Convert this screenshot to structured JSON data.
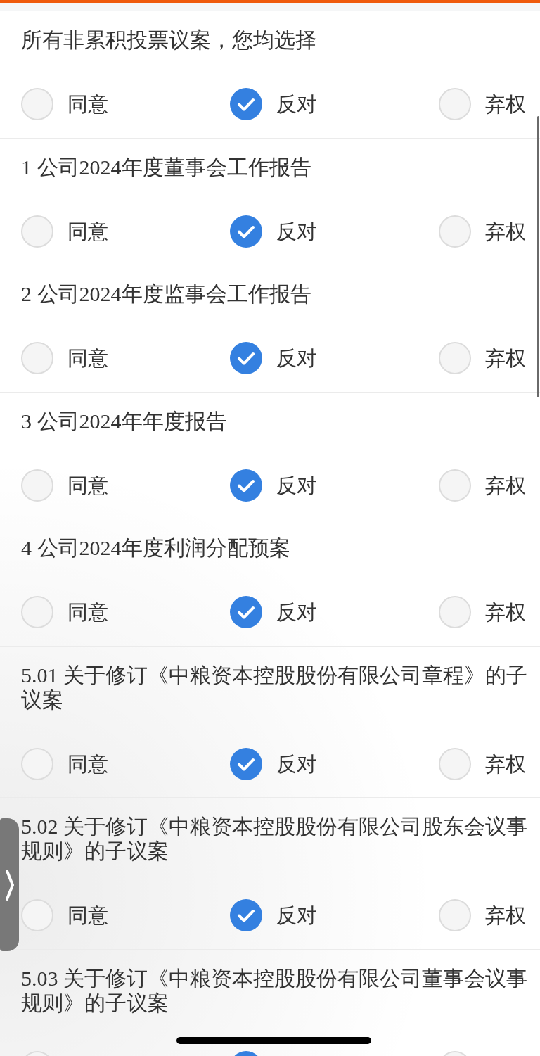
{
  "bulk_vote": {
    "title": "所有非累积投票议案，您均选择",
    "options": [
      {
        "label": "同意",
        "selected": false
      },
      {
        "label": "反对",
        "selected": true
      },
      {
        "label": "弃权",
        "selected": false
      }
    ]
  },
  "proposals": [
    {
      "title": "1 公司2024年度董事会工作报告",
      "options": [
        {
          "label": "同意",
          "selected": false
        },
        {
          "label": "反对",
          "selected": true
        },
        {
          "label": "弃权",
          "selected": false
        }
      ]
    },
    {
      "title": "2 公司2024年度监事会工作报告",
      "options": [
        {
          "label": "同意",
          "selected": false
        },
        {
          "label": "反对",
          "selected": true
        },
        {
          "label": "弃权",
          "selected": false
        }
      ]
    },
    {
      "title": "3 公司2024年年度报告",
      "options": [
        {
          "label": "同意",
          "selected": false
        },
        {
          "label": "反对",
          "selected": true
        },
        {
          "label": "弃权",
          "selected": false
        }
      ]
    },
    {
      "title": "4 公司2024年度利润分配预案",
      "options": [
        {
          "label": "同意",
          "selected": false
        },
        {
          "label": "反对",
          "selected": true
        },
        {
          "label": "弃权",
          "selected": false
        }
      ]
    },
    {
      "title": "5.01 关于修订《中粮资本控股股份有限公司章程》的子议案",
      "options": [
        {
          "label": "同意",
          "selected": false
        },
        {
          "label": "反对",
          "selected": true
        },
        {
          "label": "弃权",
          "selected": false
        }
      ]
    },
    {
      "title": "5.02 关于修订《中粮资本控股股份有限公司股东会议事规则》的子议案",
      "options": [
        {
          "label": "同意",
          "selected": false
        },
        {
          "label": "反对",
          "selected": true
        },
        {
          "label": "弃权",
          "selected": false
        }
      ]
    },
    {
      "title": "5.03 关于修订《中粮资本控股股份有限公司董事会议事规则》的子议案",
      "options": [
        {
          "selected": false
        },
        {
          "selected": true
        },
        {
          "selected": false
        }
      ]
    }
  ]
}
